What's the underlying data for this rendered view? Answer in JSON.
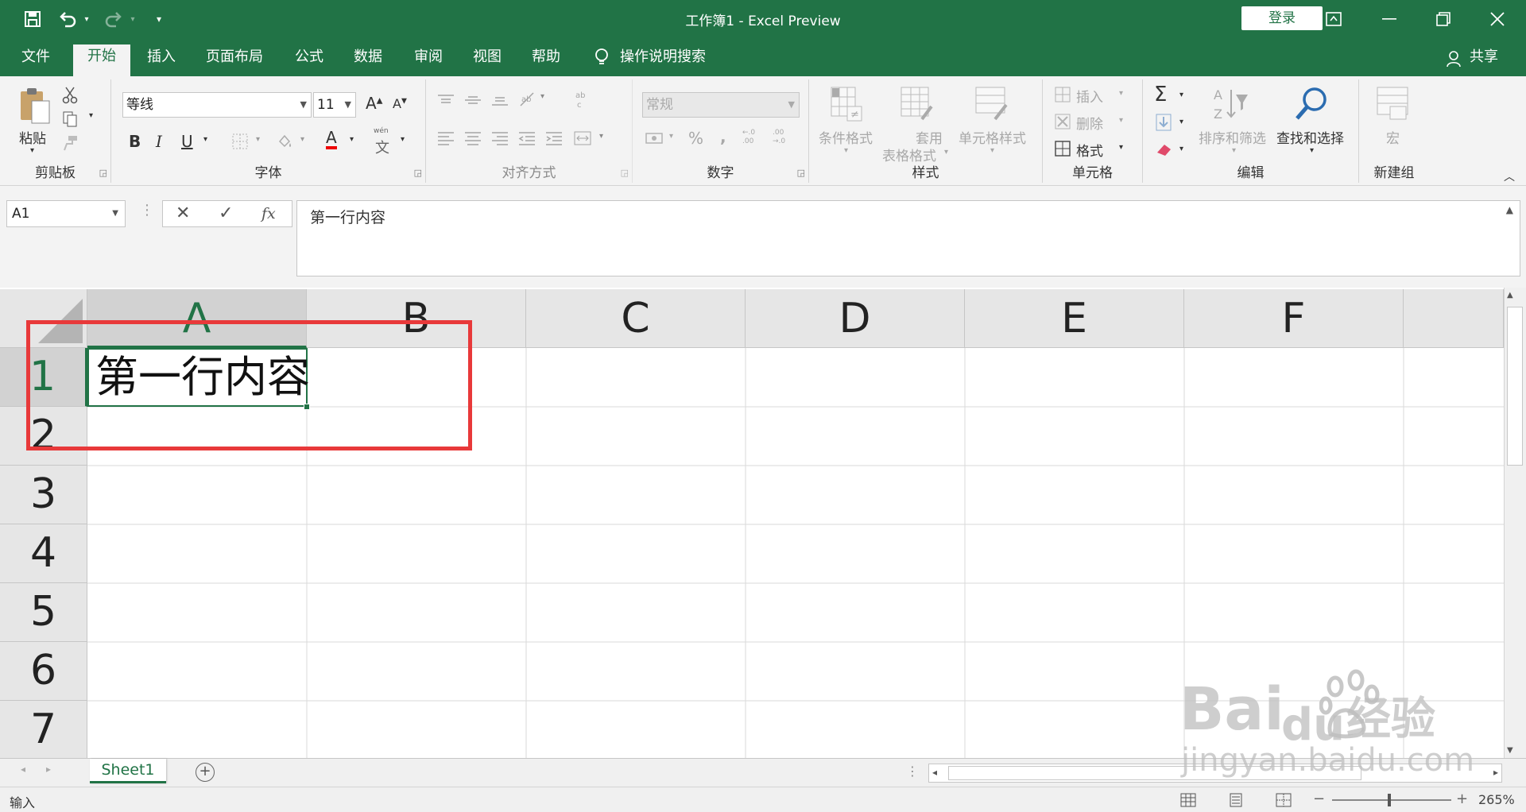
{
  "window": {
    "title": "工作簿1  -  Excel Preview",
    "login_label": "登录",
    "share_label": "共享"
  },
  "tabs": [
    "文件",
    "开始",
    "插入",
    "页面布局",
    "公式",
    "数据",
    "审阅",
    "视图",
    "帮助",
    "操作说明搜索"
  ],
  "ribbon": {
    "clipboard": {
      "paste": "粘贴",
      "label": "剪贴板"
    },
    "font": {
      "name": "等线",
      "size": "11",
      "label": "字体",
      "bold": "B",
      "italic": "I",
      "underline": "U",
      "inc": "A",
      "dec": "A",
      "wen_top": "wén",
      "wen": "文"
    },
    "align": {
      "label": "对齐方式"
    },
    "number": {
      "format": "常规",
      "label": "数字",
      "percent": "%",
      "comma": ",",
      "inc_dec": "←.0 .00",
      "dec_dec": ".00 →.0"
    },
    "styles": {
      "cond": "条件格式",
      "table1": "套用",
      "table2": "表格格式",
      "cell": "单元格样式",
      "label": "样式"
    },
    "cells": {
      "insert": "插入",
      "delete": "删除",
      "format": "格式",
      "label": "单元格"
    },
    "editing": {
      "sum": "Σ",
      "sort": "排序和筛选",
      "find": "查找和选择",
      "label": "编辑"
    },
    "newgroup": {
      "macro": "宏",
      "label": "新建组"
    }
  },
  "formula_bar": {
    "name_box": "A1",
    "cancel": "✕",
    "enter": "✓",
    "fx": "fx",
    "content": "第一行内容"
  },
  "sheet": {
    "columns": [
      "A",
      "B",
      "C",
      "D",
      "E",
      "F"
    ],
    "rows": [
      "1",
      "2",
      "3",
      "4",
      "5",
      "6",
      "7"
    ],
    "a1": "第一行内容"
  },
  "sheet_tabs": {
    "active": "Sheet1",
    "add": "+"
  },
  "status": {
    "mode": "输入",
    "zoom": "265%",
    "minus": "−",
    "plus": "+"
  },
  "watermark": {
    "brand": "Bai",
    "brand2": "du",
    "cn": "经验",
    "url": "jingyan.baidu.com"
  },
  "colors": {
    "excel_green": "#217346",
    "highlight_red": "#e8393a"
  }
}
